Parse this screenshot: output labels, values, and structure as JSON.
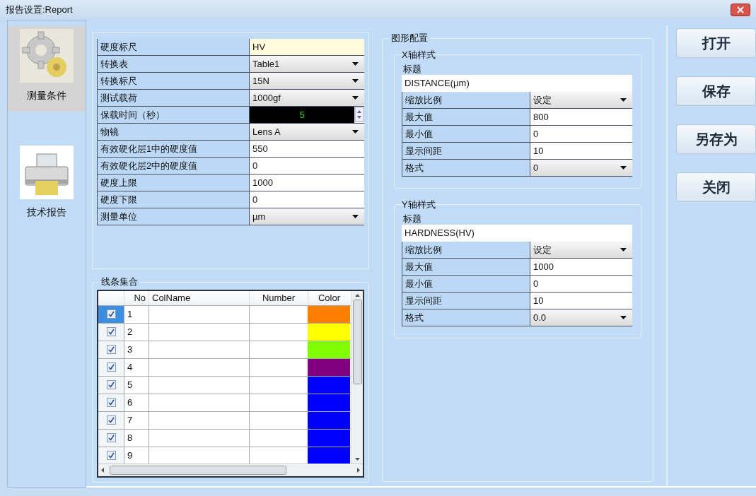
{
  "window": {
    "title": "报告设置:Report"
  },
  "sidebar": {
    "items": [
      {
        "label": "测量条件",
        "kind": "gear",
        "selected": true
      },
      {
        "label": "技术报告",
        "kind": "printer",
        "selected": false
      }
    ]
  },
  "properties": {
    "rows": [
      {
        "label": "硬度标尺",
        "value": "HV",
        "kind": "readonly"
      },
      {
        "label": "转换表",
        "value": "Table1",
        "kind": "dropdown"
      },
      {
        "label": "转换标尺",
        "value": "15N",
        "kind": "dropdown"
      },
      {
        "label": "测试载荷",
        "value": "1000gf",
        "kind": "dropdown"
      },
      {
        "label": "保载时间（秒）",
        "value": "5",
        "kind": "spinner"
      },
      {
        "label": "物镜",
        "value": "Lens A",
        "kind": "dropdown"
      },
      {
        "label": "有效硬化层1中的硬度值",
        "value": "550",
        "kind": "text"
      },
      {
        "label": "有效硬化层2中的硬度值",
        "value": "0",
        "kind": "text"
      },
      {
        "label": "硬度上限",
        "value": "1000",
        "kind": "text"
      },
      {
        "label": "硬度下限",
        "value": "0",
        "kind": "text"
      },
      {
        "label": "测量单位",
        "value": "µm",
        "kind": "dropdown"
      }
    ]
  },
  "lines": {
    "title": "线条集合",
    "columns": [
      "No",
      "ColName",
      "Number",
      "Color"
    ],
    "rows": [
      {
        "no": "1",
        "checked": true,
        "selected": true,
        "color": "#ff7f00"
      },
      {
        "no": "2",
        "checked": true,
        "selected": false,
        "color": "#ffff00"
      },
      {
        "no": "3",
        "checked": true,
        "selected": false,
        "color": "#7fff00"
      },
      {
        "no": "4",
        "checked": true,
        "selected": false,
        "color": "#800080"
      },
      {
        "no": "5",
        "checked": true,
        "selected": false,
        "color": "#0000ff"
      },
      {
        "no": "6",
        "checked": true,
        "selected": false,
        "color": "#0000ff"
      },
      {
        "no": "7",
        "checked": true,
        "selected": false,
        "color": "#0000ff"
      },
      {
        "no": "8",
        "checked": true,
        "selected": false,
        "color": "#0000ff"
      },
      {
        "no": "9",
        "checked": true,
        "selected": false,
        "color": "#0000ff"
      }
    ]
  },
  "chart_config": {
    "title": "图形配置",
    "axes": [
      {
        "title": "X轴样式",
        "caption_label": "标题",
        "caption": "DISTANCE(µm)",
        "rows": [
          {
            "label": "缩放比例",
            "value": "设定",
            "kind": "dropdown"
          },
          {
            "label": "最大值",
            "value": "800",
            "kind": "text"
          },
          {
            "label": "最小值",
            "value": "0",
            "kind": "text"
          },
          {
            "label": "显示间距",
            "value": "10",
            "kind": "text"
          },
          {
            "label": "格式",
            "value": "0",
            "kind": "dropdown"
          }
        ]
      },
      {
        "title": "Y轴样式",
        "caption_label": "标题",
        "caption": "HARDNESS(HV)",
        "rows": [
          {
            "label": "缩放比例",
            "value": "设定",
            "kind": "dropdown"
          },
          {
            "label": "最大值",
            "value": "1000",
            "kind": "text"
          },
          {
            "label": "最小值",
            "value": "0",
            "kind": "text"
          },
          {
            "label": "显示间距",
            "value": "10",
            "kind": "text"
          },
          {
            "label": "格式",
            "value": "0.0",
            "kind": "dropdown"
          }
        ]
      }
    ]
  },
  "buttons": [
    "打开",
    "保存",
    "另存为",
    "关闭"
  ]
}
